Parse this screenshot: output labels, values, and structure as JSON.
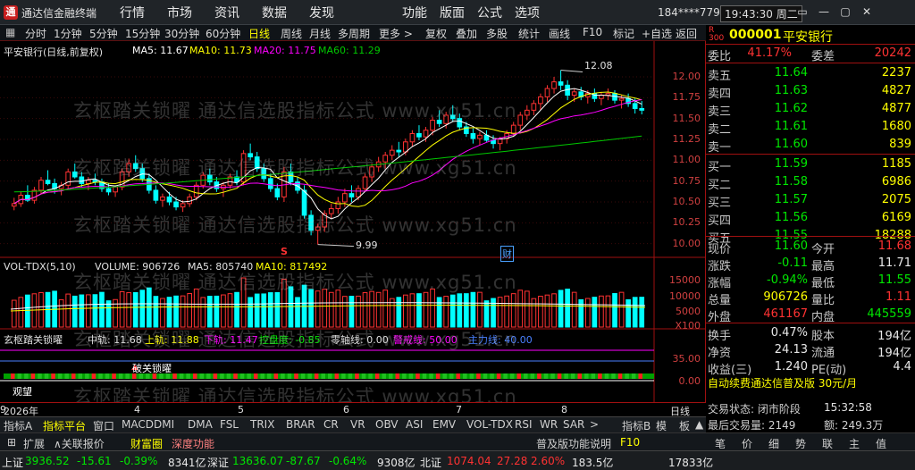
{
  "titlebar": {
    "logo": "通",
    "app_title": "通达信金融终端",
    "menus": [
      "行情",
      "市场",
      "资讯",
      "数据",
      "发现"
    ],
    "menus2": [
      "功能",
      "版面",
      "公式",
      "选项"
    ],
    "user": "184****7797",
    "time": "19:43:30 周二",
    "window_controls": [
      "▭",
      "—",
      "▢",
      "✕"
    ]
  },
  "toolbar": {
    "items": [
      "分时",
      "1分钟",
      "5分钟",
      "15分钟",
      "30分钟",
      "60分钟",
      "日线",
      "周线",
      "月线",
      "多周期",
      "更多 >",
      "复权",
      "叠加",
      "多股",
      "统计",
      "画线",
      "F10",
      "标记",
      "+自选",
      "返回"
    ],
    "active": "日线"
  },
  "main_chart": {
    "header_title": "平安银行(日线,前复权)",
    "ma5": "MA5: 11.67",
    "ma10": "MA10: 11.73",
    "ma20": "MA20: 11.75",
    "ma60": "MA60: 11.29",
    "high_label": "12.08",
    "low_label": "9.99",
    "marker_s": "S",
    "marker_cai": "财",
    "y_ticks": [
      "12.00",
      "11.75",
      "11.50",
      "11.25",
      "11.00",
      "10.75",
      "10.50",
      "10.25",
      "10.00"
    ]
  },
  "volume_chart": {
    "header": "VOL-TDX(5,10)",
    "volume": "VOLUME: 906726",
    "ma5": "MA5: 805740",
    "ma10": "MA10: 817492",
    "y_ticks": [
      "15000",
      "10000",
      "5000",
      "X100"
    ]
  },
  "indicator_chart": {
    "name": "玄枢踏关锁曜",
    "zhong": "中轨: 11.68",
    "shang": "上轨: 11.88",
    "xia": "下轨: 11.47",
    "kongpan": "控盘度: -0.85",
    "lingzhou": "零轴线: 0.00",
    "jingjie": "警戒线: 50.00",
    "zhuli": "主力线: 40.00",
    "breakout_label": "破关锁曜",
    "watch_label": "观望",
    "y_ticks": [
      "35.00",
      "0.00"
    ]
  },
  "timeline": {
    "labels": [
      "2026年",
      "4",
      "5",
      "6",
      "7",
      "8",
      "9"
    ],
    "period": "日线"
  },
  "bottom_tabs": [
    "指标A",
    "指标平台",
    "窗口",
    "MACD",
    "DMI",
    "DMA",
    "FSL",
    "TRIX",
    "BRAR",
    "CR",
    "VR",
    "OBV",
    "ASI",
    "EMV",
    "VOL-TDX",
    "RSI",
    "WR",
    "SAR",
    ">",
    "指标B",
    "模",
    "板",
    "▲"
  ],
  "bottom2": {
    "left_items": [
      "⊞",
      "扩展",
      "∧关联报价",
      "财富圈",
      "深度功能"
    ],
    "promo": "普及版功能说明",
    "f10": "F10"
  },
  "right_panel": {
    "code": "000001",
    "name": "平安银行",
    "weibi_label": "委比",
    "weibi_val": "41.17%",
    "weicha_label": "委差",
    "weicha_val": "20242",
    "asks": [
      {
        "label": "卖五",
        "price": "11.64",
        "vol": "2237"
      },
      {
        "label": "卖四",
        "price": "11.63",
        "vol": "4827"
      },
      {
        "label": "卖三",
        "price": "11.62",
        "vol": "4877"
      },
      {
        "label": "卖二",
        "price": "11.61",
        "vol": "1680"
      },
      {
        "label": "卖一",
        "price": "11.60",
        "vol": "839"
      }
    ],
    "bids": [
      {
        "label": "买一",
        "price": "11.59",
        "vol": "1185"
      },
      {
        "label": "买二",
        "price": "11.58",
        "vol": "6986"
      },
      {
        "label": "买三",
        "price": "11.57",
        "vol": "2075"
      },
      {
        "label": "买四",
        "price": "11.56",
        "vol": "6169"
      },
      {
        "label": "买五",
        "price": "11.55",
        "vol": "18288"
      }
    ],
    "stats": [
      {
        "l1": "现价",
        "v1": "11.60",
        "c1": "green",
        "l2": "今开",
        "v2": "11.68",
        "c2": "red"
      },
      {
        "l1": "涨跌",
        "v1": "-0.11",
        "c1": "green",
        "l2": "最高",
        "v2": "11.71",
        "c2": "white"
      },
      {
        "l1": "涨幅",
        "v1": "-0.94%",
        "c1": "green",
        "l2": "最低",
        "v2": "11.55",
        "c2": "green"
      },
      {
        "l1": "总量",
        "v1": "906726",
        "c1": "yellow",
        "l2": "量比",
        "v2": "1.11",
        "c2": "red"
      },
      {
        "l1": "外盘",
        "v1": "461167",
        "c1": "red",
        "l2": "内盘",
        "v2": "445559",
        "c2": "green"
      }
    ],
    "stats2": [
      {
        "l1": "换手",
        "v1": "0.47%",
        "l2": "股本",
        "v2": "194亿"
      },
      {
        "l1": "净资",
        "v1": "24.13",
        "l2": "流通",
        "v2": "194亿"
      },
      {
        "l1": "收益(三)",
        "v1": "1.240",
        "l2": "PE(动)",
        "v2": "4.4"
      }
    ],
    "promo": "自动续费通达信普及版 30元/月",
    "trade_status": "交易状态: 闭市阶段",
    "trade_time": "15:32:58",
    "last_vol": "最后交易量: 2149",
    "last_amount": "额: 249.3万",
    "btn_labels": [
      "笔",
      "价",
      "细",
      "势",
      "联",
      "主",
      "值"
    ]
  },
  "status_bar": {
    "sh_label": "上证",
    "sh_val": "3936.52",
    "sh_chg": "-15.61",
    "sh_pct": "-0.39%",
    "sh_amt": "8341亿",
    "sz_label": "深证",
    "sz_val": "13636.07",
    "sz_chg": "-87.67",
    "sz_pct": "-0.64%",
    "sz_amt": "9308亿",
    "bz_label": "北证",
    "bz_val": "1074.04",
    "bz_chg": "27.28",
    "bz_pct": "2.60%",
    "bz_amt": "183.5亿",
    "cyb_amt": "17833亿"
  },
  "watermark_text": "玄枢踏关锁曜 通达信选股指标公式 www.xg51.cn",
  "colors": {
    "up": "#ff3232",
    "down": "#00ffff",
    "ma5": "#ffffff",
    "ma10": "#ffff00",
    "ma20": "#ff00ff",
    "ma60": "#00c800",
    "frame": "#a01010"
  },
  "chart_data": {
    "type": "candlestick",
    "title": "平安银行(日线,前复权)",
    "ylim": [
      9.9,
      12.15
    ],
    "y_ticks": [
      10.0,
      10.25,
      10.5,
      10.75,
      11.0,
      11.25,
      11.5,
      11.75,
      12.0
    ],
    "candles": [
      [
        10.45,
        10.55,
        10.4,
        10.48
      ],
      [
        10.48,
        10.62,
        10.44,
        10.58
      ],
      [
        10.58,
        10.7,
        10.5,
        10.52
      ],
      [
        10.52,
        10.68,
        10.48,
        10.64
      ],
      [
        10.64,
        10.8,
        10.6,
        10.76
      ],
      [
        10.76,
        10.88,
        10.7,
        10.72
      ],
      [
        10.72,
        10.78,
        10.6,
        10.66
      ],
      [
        10.66,
        10.74,
        10.58,
        10.7
      ],
      [
        10.7,
        10.9,
        10.66,
        10.86
      ],
      [
        10.86,
        10.96,
        10.78,
        10.8
      ],
      [
        10.8,
        10.86,
        10.68,
        10.72
      ],
      [
        10.72,
        10.8,
        10.64,
        10.76
      ],
      [
        10.76,
        10.84,
        10.7,
        10.74
      ],
      [
        10.74,
        10.78,
        10.62,
        10.66
      ],
      [
        10.66,
        10.72,
        10.58,
        10.62
      ],
      [
        10.62,
        10.7,
        10.56,
        10.68
      ],
      [
        10.68,
        10.9,
        10.64,
        10.86
      ],
      [
        10.86,
        11.02,
        10.8,
        10.96
      ],
      [
        10.96,
        11.06,
        10.86,
        10.9
      ],
      [
        10.9,
        10.96,
        10.74,
        10.78
      ],
      [
        10.78,
        10.84,
        10.6,
        10.64
      ],
      [
        10.64,
        10.7,
        10.48,
        10.52
      ],
      [
        10.52,
        10.6,
        10.44,
        10.56
      ],
      [
        10.56,
        10.62,
        10.46,
        10.5
      ],
      [
        10.5,
        10.56,
        10.4,
        10.44
      ],
      [
        10.44,
        10.52,
        10.38,
        10.48
      ],
      [
        10.48,
        10.6,
        10.44,
        10.56
      ],
      [
        10.56,
        10.74,
        10.52,
        10.7
      ],
      [
        10.7,
        10.86,
        10.66,
        10.82
      ],
      [
        10.82,
        10.9,
        10.7,
        10.74
      ],
      [
        10.74,
        10.8,
        10.62,
        10.66
      ],
      [
        10.66,
        10.74,
        10.56,
        10.7
      ],
      [
        10.7,
        10.84,
        10.66,
        10.8
      ],
      [
        10.8,
        10.88,
        10.7,
        10.74
      ],
      [
        10.74,
        11.12,
        10.7,
        11.08
      ],
      [
        11.08,
        11.2,
        11.0,
        11.04
      ],
      [
        11.04,
        11.1,
        10.86,
        10.9
      ],
      [
        10.9,
        10.96,
        10.74,
        10.78
      ],
      [
        10.78,
        10.84,
        10.62,
        10.66
      ],
      [
        10.66,
        10.72,
        10.52,
        10.56
      ],
      [
        10.56,
        10.92,
        10.5,
        10.86
      ],
      [
        10.86,
        10.96,
        10.7,
        10.74
      ],
      [
        10.74,
        10.8,
        10.6,
        10.64
      ],
      [
        10.64,
        10.7,
        10.3,
        10.34
      ],
      [
        10.34,
        10.4,
        10.1,
        10.16
      ],
      [
        10.16,
        10.24,
        9.99,
        10.2
      ],
      [
        10.2,
        10.4,
        10.14,
        10.36
      ],
      [
        10.36,
        10.48,
        10.3,
        10.42
      ],
      [
        10.42,
        10.56,
        10.36,
        10.5
      ],
      [
        10.5,
        10.66,
        10.44,
        10.6
      ],
      [
        10.6,
        10.7,
        10.5,
        10.56
      ],
      [
        10.56,
        10.7,
        10.52,
        10.66
      ],
      [
        10.66,
        10.84,
        10.62,
        10.8
      ],
      [
        10.8,
        10.96,
        10.74,
        10.92
      ],
      [
        10.92,
        11.04,
        10.86,
        10.98
      ],
      [
        10.98,
        11.1,
        10.9,
        11.06
      ],
      [
        11.06,
        11.18,
        11.0,
        11.12
      ],
      [
        11.12,
        11.22,
        11.04,
        11.1
      ],
      [
        11.1,
        11.26,
        11.06,
        11.22
      ],
      [
        11.22,
        11.36,
        11.16,
        11.32
      ],
      [
        11.32,
        11.42,
        11.24,
        11.28
      ],
      [
        11.28,
        11.4,
        11.22,
        11.36
      ],
      [
        11.36,
        11.52,
        11.3,
        11.48
      ],
      [
        11.48,
        11.6,
        11.4,
        11.44
      ],
      [
        11.44,
        11.58,
        11.38,
        11.54
      ],
      [
        11.54,
        11.66,
        11.46,
        11.5
      ],
      [
        11.5,
        11.56,
        11.36,
        11.4
      ],
      [
        11.4,
        11.46,
        11.28,
        11.32
      ],
      [
        11.32,
        11.38,
        11.2,
        11.26
      ],
      [
        11.26,
        11.34,
        11.18,
        11.3
      ],
      [
        11.3,
        11.36,
        11.22,
        11.24
      ],
      [
        11.24,
        11.3,
        11.14,
        11.2
      ],
      [
        11.2,
        11.28,
        11.12,
        11.26
      ],
      [
        11.26,
        11.36,
        11.2,
        11.32
      ],
      [
        11.32,
        11.46,
        11.28,
        11.42
      ],
      [
        11.42,
        11.58,
        11.36,
        11.54
      ],
      [
        11.54,
        11.66,
        11.48,
        11.6
      ],
      [
        11.6,
        11.72,
        11.54,
        11.68
      ],
      [
        11.68,
        11.8,
        11.6,
        11.76
      ],
      [
        11.76,
        11.9,
        11.7,
        11.86
      ],
      [
        11.86,
        12.0,
        11.8,
        11.94
      ],
      [
        11.94,
        12.08,
        11.84,
        11.9
      ],
      [
        11.9,
        11.96,
        11.72,
        11.78
      ],
      [
        11.78,
        11.86,
        11.7,
        11.82
      ],
      [
        11.82,
        11.88,
        11.72,
        11.76
      ],
      [
        11.76,
        11.84,
        11.68,
        11.8
      ],
      [
        11.8,
        11.86,
        11.7,
        11.74
      ],
      [
        11.74,
        11.82,
        11.66,
        11.78
      ],
      [
        11.78,
        11.86,
        11.72,
        11.8
      ],
      [
        11.8,
        11.84,
        11.68,
        11.72
      ],
      [
        11.72,
        11.78,
        11.62,
        11.74
      ],
      [
        11.74,
        11.8,
        11.64,
        11.68
      ],
      [
        11.68,
        11.74,
        11.56,
        11.62
      ],
      [
        11.62,
        11.71,
        11.55,
        11.6
      ]
    ],
    "ma60_start": 10.62,
    "ma60_end": 11.29,
    "volume_ylim": [
      0,
      18000
    ],
    "volume_y_ticks": [
      5000,
      10000,
      15000
    ]
  }
}
